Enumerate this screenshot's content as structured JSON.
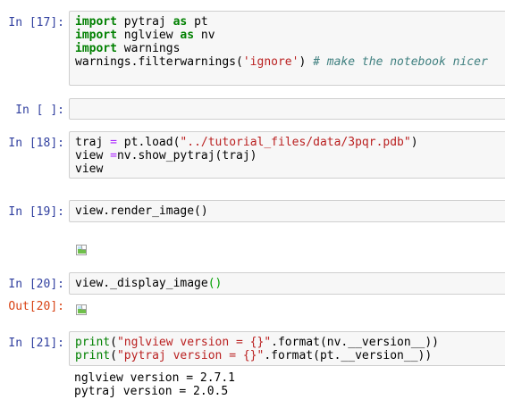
{
  "cells": [
    {
      "prompt": "In [17]:",
      "lines": [
        [
          {
            "t": "import",
            "c": "kw"
          },
          {
            "t": " pytraj "
          },
          {
            "t": "as",
            "c": "kw"
          },
          {
            "t": " pt"
          }
        ],
        [
          {
            "t": "import",
            "c": "kw"
          },
          {
            "t": " nglview "
          },
          {
            "t": "as",
            "c": "kw"
          },
          {
            "t": " nv"
          }
        ],
        [
          {
            "t": "import",
            "c": "kw"
          },
          {
            "t": " warnings"
          }
        ],
        [
          {
            "t": "warnings.filterwarnings("
          },
          {
            "t": "'ignore'",
            "c": "str"
          },
          {
            "t": ") "
          },
          {
            "t": "# make the notebook nicer",
            "c": "cmt"
          }
        ]
      ]
    },
    {
      "prompt": "In [ ]:",
      "lines": []
    },
    {
      "prompt": "In [18]:",
      "lines": [
        [
          {
            "t": "traj "
          },
          {
            "t": "=",
            "c": "op"
          },
          {
            "t": " pt.load("
          },
          {
            "t": "\"../tutorial_files/data/3pqr.pdb\"",
            "c": "str"
          },
          {
            "t": ")"
          }
        ],
        [
          {
            "t": "view "
          },
          {
            "t": "=",
            "c": "op"
          },
          {
            "t": "nv.show_pytraj(traj)"
          }
        ],
        [
          {
            "t": "view"
          }
        ]
      ]
    },
    {
      "prompt": "In [19]:",
      "lines": [
        [
          {
            "t": "view.render_image()"
          }
        ]
      ]
    },
    {
      "prompt": "In [20]:",
      "out_prompt": "Out[20]:",
      "lines": [
        [
          {
            "t": "view._display_image"
          },
          {
            "t": "()",
            "c": "paren-hl"
          }
        ]
      ]
    },
    {
      "prompt": "In [21]:",
      "lines": [
        [
          {
            "t": "print",
            "c": "fn"
          },
          {
            "t": "("
          },
          {
            "t": "\"nglview version = {}\"",
            "c": "str"
          },
          {
            "t": ".format(nv.__version__))"
          }
        ],
        [
          {
            "t": "print",
            "c": "fn"
          },
          {
            "t": "("
          },
          {
            "t": "\"pytraj version = {}\"",
            "c": "str"
          },
          {
            "t": ".format(pt.__version__))"
          }
        ]
      ],
      "output": [
        "nglview version = 2.7.1",
        "pytraj version = 2.0.5"
      ]
    }
  ],
  "images": {
    "broken_image_icon": "broken-image-icon"
  }
}
